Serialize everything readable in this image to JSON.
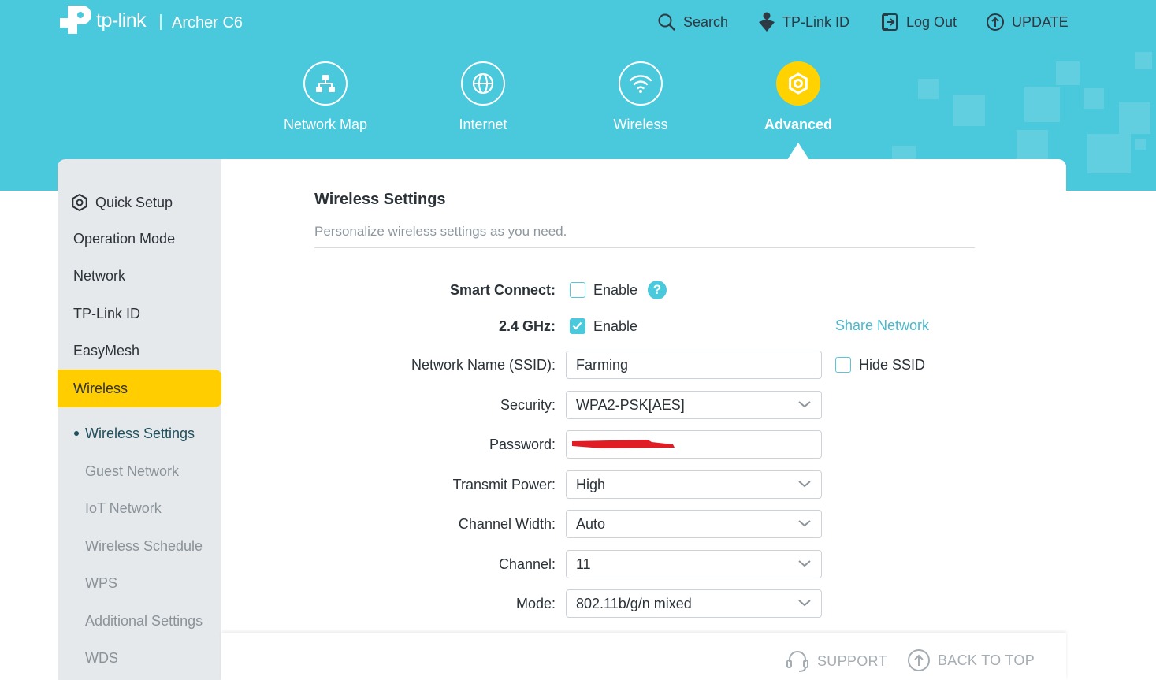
{
  "header": {
    "brand": "tp-link",
    "model": "Archer C6",
    "links": {
      "search": "Search",
      "tplink_id": "TP-Link ID",
      "logout": "Log Out",
      "update": "UPDATE"
    },
    "nav": [
      {
        "label": "Network Map"
      },
      {
        "label": "Internet"
      },
      {
        "label": "Wireless"
      },
      {
        "label": "Advanced"
      }
    ]
  },
  "sidebar": {
    "items": [
      {
        "label": "Quick Setup"
      },
      {
        "label": "Operation Mode"
      },
      {
        "label": "Network"
      },
      {
        "label": "TP-Link ID"
      },
      {
        "label": "EasyMesh"
      },
      {
        "label": "Wireless"
      }
    ],
    "sub_items": [
      {
        "label": "Wireless Settings"
      },
      {
        "label": "Guest Network"
      },
      {
        "label": "IoT Network"
      },
      {
        "label": "Wireless Schedule"
      },
      {
        "label": "WPS"
      },
      {
        "label": "Additional Settings"
      },
      {
        "label": "WDS"
      }
    ]
  },
  "main": {
    "title": "Wireless Settings",
    "subtitle": "Personalize wireless settings as you need.",
    "smart_connect": {
      "label": "Smart Connect:",
      "option": "Enable",
      "help": "?"
    },
    "band": {
      "label": "2.4 GHz:",
      "option": "Enable",
      "share": "Share Network"
    },
    "ssid": {
      "label": "Network Name (SSID):",
      "value": "Farming",
      "hide": "Hide SSID"
    },
    "security": {
      "label": "Security:",
      "value": "WPA2-PSK[AES]"
    },
    "password": {
      "label": "Password:"
    },
    "transmit_power": {
      "label": "Transmit Power:",
      "value": "High"
    },
    "channel_width": {
      "label": "Channel Width:",
      "value": "Auto"
    },
    "channel": {
      "label": "Channel:",
      "value": "11"
    },
    "mode": {
      "label": "Mode:",
      "value": "802.11b/g/n mixed"
    }
  },
  "footer": {
    "support": "SUPPORT",
    "back_to_top": "BACK TO TOP"
  },
  "colors": {
    "accent": "#4ac8dc",
    "active": "#ffcd00",
    "redaction": "#e01c24"
  }
}
